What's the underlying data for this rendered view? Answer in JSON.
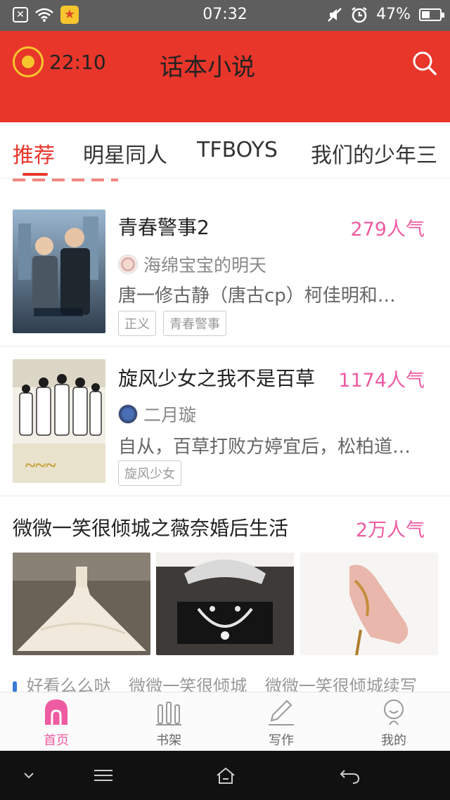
{
  "status_bar": {
    "time": "07:32",
    "battery": "47%",
    "battery_level": 0.47,
    "icons": [
      "close-box-icon",
      "wifi-icon",
      "app-badge-icon",
      "mute-icon",
      "alarm-icon",
      "battery-icon"
    ]
  },
  "header": {
    "timer": "22:10",
    "title": "话本小说",
    "icons": [
      "alarm-coin-icon",
      "search-icon"
    ]
  },
  "tabs": [
    {
      "label": "推荐",
      "active": true
    },
    {
      "label": "明星同人",
      "active": false
    },
    {
      "label": "TFBOYS",
      "active": false
    },
    {
      "label": "我们的少年三",
      "active": false
    }
  ],
  "books": [
    {
      "title": "青春警事2",
      "popularity": "279人气",
      "author": "海绵宝宝的明天",
      "description": "唐一修古静（唐古cp）柯佳明和…",
      "tags": [
        "正义",
        "青春警事"
      ]
    },
    {
      "title": "旋风少女之我不是百草",
      "popularity": "1174人气",
      "author": "二月璇",
      "description": "自从，百草打败方婷宜后，松柏道…",
      "tags": [
        "旋风少女"
      ]
    }
  ],
  "featured": {
    "title": "微微一笑很倾城之薇奈婚后生活",
    "popularity": "2万人气",
    "tags": [
      "好看么么哒",
      "微微一笑很倾城",
      "微微一笑很倾城续写"
    ]
  },
  "bottom_nav": [
    {
      "label": "首页",
      "icon": "home-icon",
      "active": true
    },
    {
      "label": "书架",
      "icon": "bookshelf-icon",
      "active": false
    },
    {
      "label": "写作",
      "icon": "pencil-icon",
      "active": false
    },
    {
      "label": "我的",
      "icon": "profile-icon",
      "active": false
    }
  ],
  "system_nav": [
    "chevron-down-icon",
    "menu-icon",
    "home-outline-icon",
    "back-icon"
  ],
  "colors": {
    "brand_red": "#e8362b",
    "popularity_pink": "#ee5ba0",
    "status_bar": "#5e5e5e"
  }
}
